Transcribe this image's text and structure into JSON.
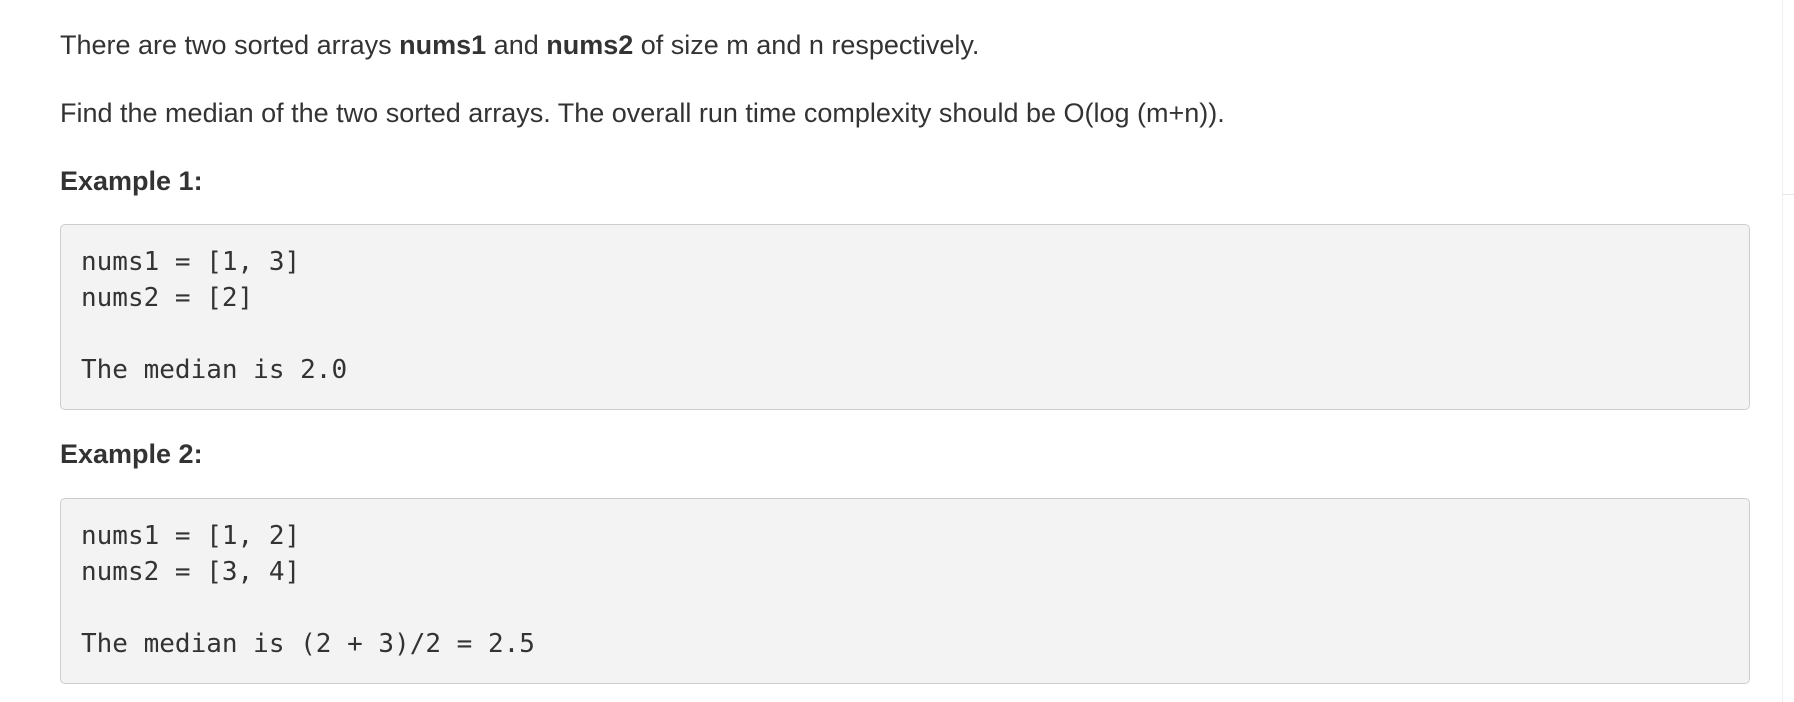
{
  "problem": {
    "intro": {
      "p1": "There are two sorted arrays ",
      "p2": "nums1",
      "p3": " and ",
      "p4": "nums2",
      "p5": " of size m and n respectively."
    },
    "task": "Find the median of the two sorted arrays. The overall run time complexity should be O(log (m+n))."
  },
  "examples": [
    {
      "heading": "Example 1:",
      "lines": [
        "nums1 = [1, 3]",
        "nums2 = [2]",
        "The median is 2.0"
      ]
    },
    {
      "heading": "Example 2:",
      "lines": [
        "nums1 = [1, 2]",
        "nums2 = [3, 4]",
        "The median is (2 + 3)/2 = 2.5"
      ]
    }
  ]
}
